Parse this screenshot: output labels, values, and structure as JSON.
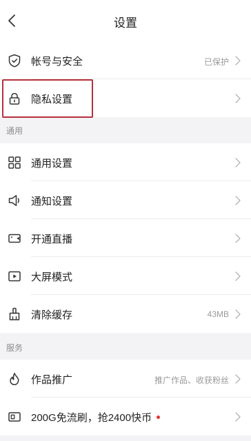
{
  "header": {
    "title": "设置"
  },
  "groups": {
    "account": {
      "items": [
        {
          "label": "帐号与安全",
          "value": "已保护"
        },
        {
          "label": "隐私设置",
          "value": ""
        }
      ]
    },
    "general": {
      "title": "通用",
      "items": [
        {
          "label": "通用设置",
          "value": ""
        },
        {
          "label": "通知设置",
          "value": ""
        },
        {
          "label": "开通直播",
          "value": ""
        },
        {
          "label": "大屏模式",
          "value": ""
        },
        {
          "label": "清除缓存",
          "value": "43MB"
        }
      ]
    },
    "services": {
      "title": "服务",
      "items": [
        {
          "label": "作品推广",
          "value": "推广作品、收获粉丝"
        },
        {
          "label": "200G免流刷，抢2400快币",
          "value": ""
        }
      ]
    }
  },
  "colors": {
    "highlight_border": "#b5303a",
    "badge_dot": "#e5362f"
  }
}
